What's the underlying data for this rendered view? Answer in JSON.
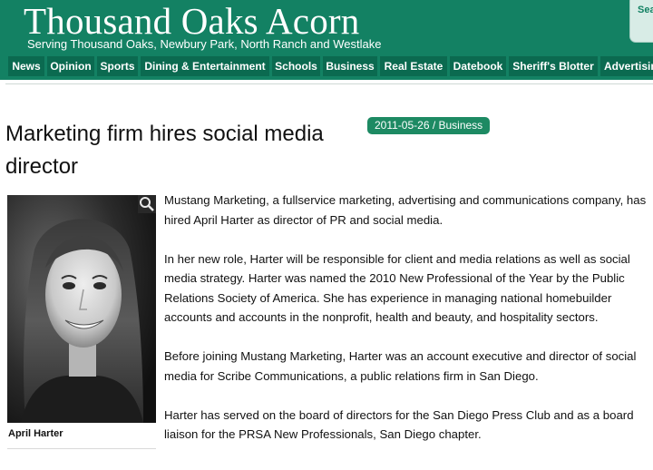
{
  "header": {
    "title": "Thousand Oaks Acorn",
    "tagline": "Serving Thousand Oaks, Newbury Park, North Ranch and Westlake",
    "search_label": "Sea"
  },
  "nav": {
    "items": [
      "News",
      "Opinion",
      "Sports",
      "Dining & Entertainment",
      "Schools",
      "Business",
      "Real Estate",
      "Datebook",
      "Sheriff's Blotter",
      "Advertising"
    ]
  },
  "article": {
    "headline": "Marketing firm hires social media director",
    "dateline": "2011-05-26 / Business",
    "photo_caption": "April Harter",
    "paragraphs": [
      "Mustang Marketing, a fullservice marketing, advertising and communications company, has hired April Harter as director of PR and social media.",
      "In her new role, Harter will be responsible for client and media relations as well as social media strategy. Harter was named the 2010 New Professional of the Year by the Public Relations Society of America. She has experience in managing national homebuilder accounts and accounts in the nonprofit, health and beauty, and hospitality sectors.",
      "Before joining Mustang Marketing, Harter was an account executive and director of social media for Scribe Communications, a public relations firm in San Diego.",
      "Harter has served on the board of directors for the San Diego Press Club and as a board liaison for the PRSA New Professionals, San Diego chapter."
    ]
  },
  "colors": {
    "brand_green": "#138163",
    "nav_button": "#0b6a50",
    "date_badge": "#1d8a63"
  },
  "icons": {
    "zoom": "magnifier-icon",
    "search": "search-icon"
  }
}
